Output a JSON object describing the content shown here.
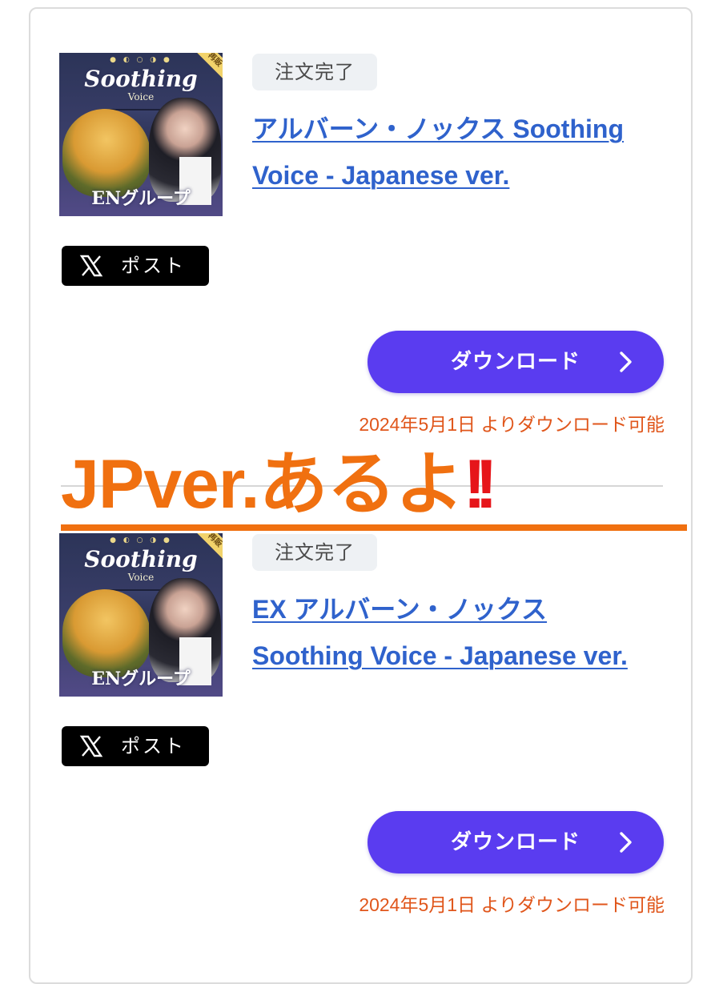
{
  "items": [
    {
      "status": "注文完了",
      "title": "アルバーン・ノックス Soothing Voice - Japanese ver.",
      "thumbnail": {
        "title": "Soothing",
        "subtitle": "Voice",
        "group": "ENグループ",
        "badge": "再販"
      },
      "post_label": "ポスト",
      "download_label": "ダウンロード",
      "availability": "2024年5月1日 よりダウンロード可能"
    },
    {
      "status": "注文完了",
      "title": "EX アルバーン・ノックス Soothing Voice - Japanese ver.",
      "thumbnail": {
        "title": "Soothing",
        "subtitle": "Voice",
        "group": "ENグループ",
        "badge": "再販"
      },
      "post_label": "ポスト",
      "download_label": "ダウンロード",
      "availability": "2024年5月1日 よりダウンロード可能"
    }
  ],
  "overlay": {
    "text": "JPver.あるよ",
    "marks": "!!",
    "color": "#f07010",
    "marks_color": "#e6151a"
  },
  "colors": {
    "download_button": "#5a3cf0",
    "link": "#2f62cc",
    "availability": "#e0561b",
    "status_bg": "#eef1f4"
  },
  "icons": {
    "post": "x-logo-icon",
    "download": "chevron-right-icon"
  }
}
